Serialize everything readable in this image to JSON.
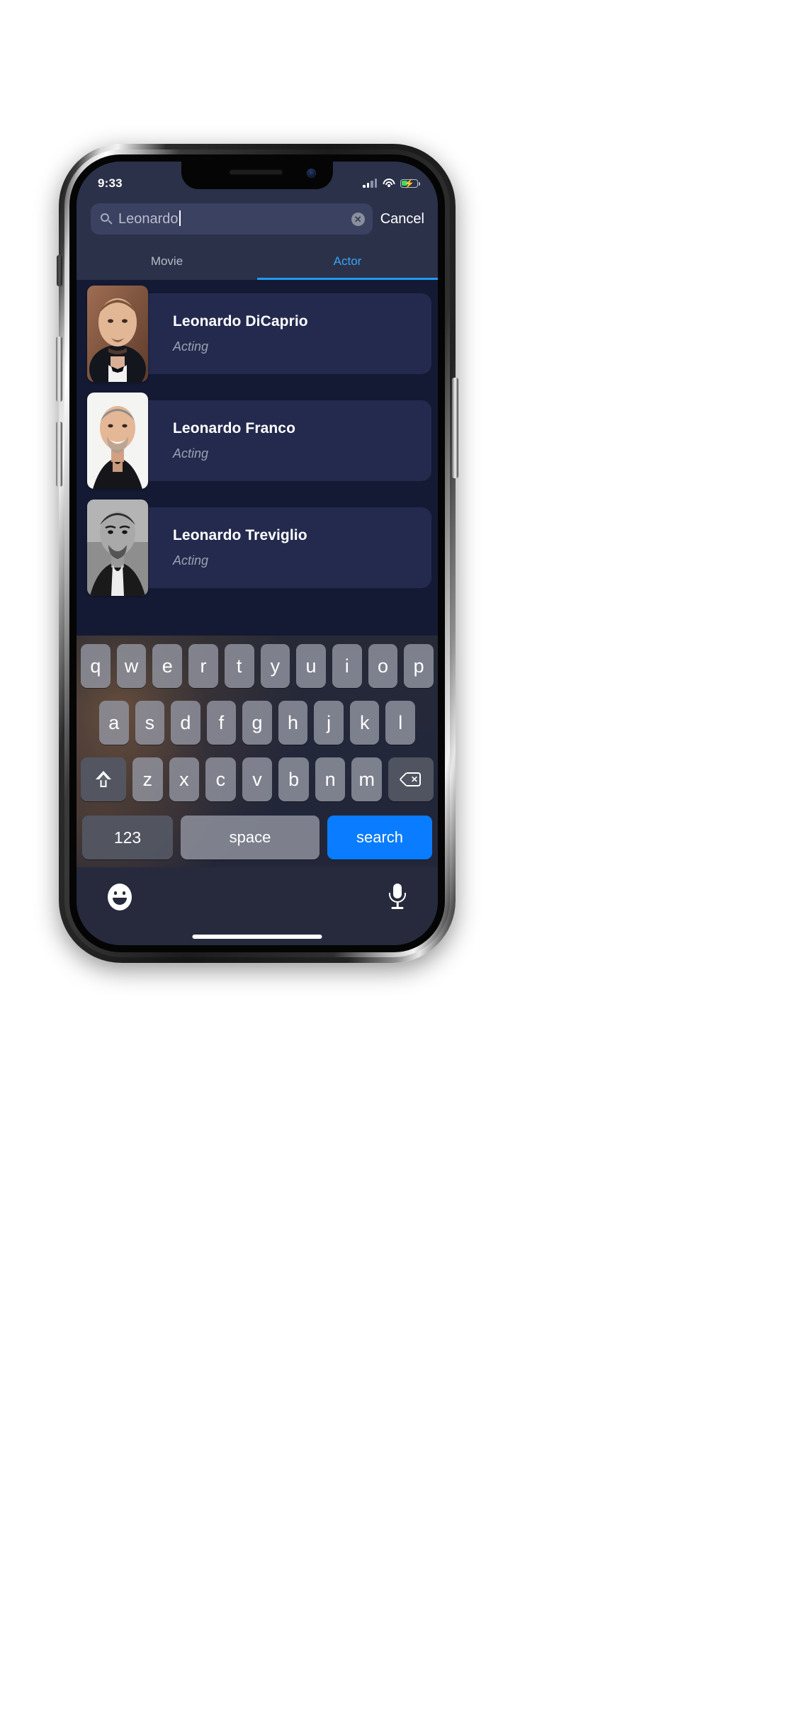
{
  "status_bar": {
    "time": "9:33",
    "cellular_icon": "cellular-signal-icon",
    "wifi_icon": "wifi-icon",
    "battery_icon": "battery-charging-icon",
    "battery_charging": true
  },
  "search": {
    "value": "Leonardo",
    "placeholder": "Search",
    "search_icon": "search-icon",
    "clear_icon": "clear-circle-icon",
    "clear_glyph": "✕",
    "cancel_label": "Cancel"
  },
  "tabs": [
    {
      "label": "Movie",
      "active": false
    },
    {
      "label": "Actor",
      "active": true
    }
  ],
  "results": [
    {
      "name": "Leonardo DiCaprio",
      "department": "Acting"
    },
    {
      "name": "Leonardo Franco",
      "department": "Acting"
    },
    {
      "name": "Leonardo Treviglio",
      "department": "Acting"
    }
  ],
  "keyboard": {
    "row1": [
      "q",
      "w",
      "e",
      "r",
      "t",
      "y",
      "u",
      "i",
      "o",
      "p"
    ],
    "row2": [
      "a",
      "s",
      "d",
      "f",
      "g",
      "h",
      "j",
      "k",
      "l"
    ],
    "row3": [
      "z",
      "x",
      "c",
      "v",
      "b",
      "n",
      "m"
    ],
    "shift_icon": "shift-icon",
    "delete_icon": "backspace-icon",
    "numbers_label": "123",
    "space_label": "space",
    "return_label": "search",
    "emoji_icon": "emoji-smiley-icon",
    "mic_icon": "microphone-icon"
  },
  "colors": {
    "accent_blue": "#1f9bf5",
    "return_key_blue": "#0a7cff",
    "page_background": "#141a33",
    "card_background": "#242a4d",
    "chrome_background": "#2b3149",
    "battery_green": "#3ddc5b"
  }
}
